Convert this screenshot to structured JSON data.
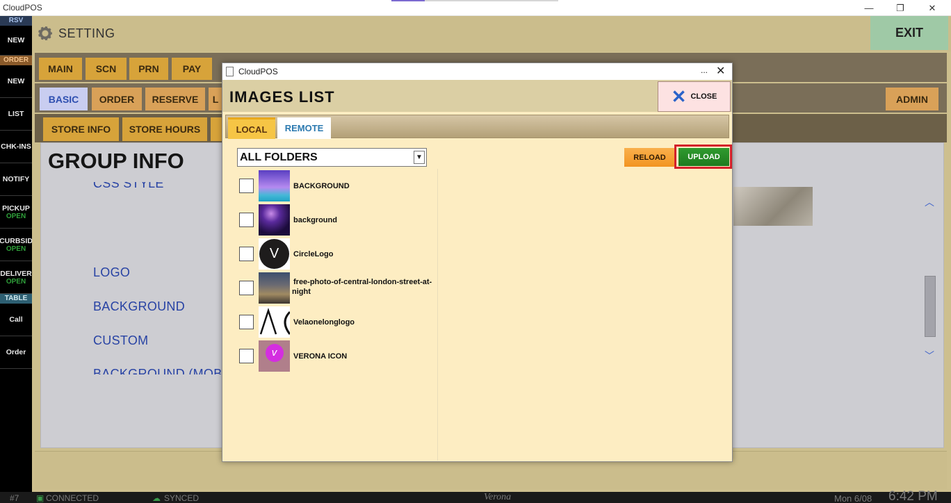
{
  "os": {
    "title": "CloudPOS",
    "minimize": "—",
    "restore": "❐",
    "close": "✕"
  },
  "sidebar": {
    "rsv_header": "RSV",
    "rsv_new": "NEW",
    "order_header": "ORDER",
    "order_new": "NEW",
    "list": "LIST",
    "chkins": "CHK-INS",
    "notify": "NOTIFY",
    "pickup": "PICKUP",
    "pickup_status": "OPEN",
    "curbside": "CURBSID",
    "curbside_status": "OPEN",
    "delivery": "DELIVER",
    "delivery_status": "OPEN",
    "table_header": "TABLE",
    "call": "Call",
    "order": "Order"
  },
  "header": {
    "title": "SETTING",
    "exit": "EXIT"
  },
  "main_tabs": [
    "MAIN",
    "SCN",
    "PRN",
    "PAY"
  ],
  "sub_tabs": {
    "basic": "BASIC",
    "order": "ORDER",
    "reserve": "RESERVE",
    "l": "L",
    "admin": "ADMIN"
  },
  "info_tabs": {
    "store_info": "STORE INFO",
    "store_hours": "STORE HOURS"
  },
  "content": {
    "group_title": "GROUP INFO",
    "labels": {
      "css_style": "CSS STYLE",
      "logo": "LOGO",
      "background": "BACKGROUND",
      "custom": "CUSTOM",
      "background_mobile": "BACKGROUND (MOBI"
    }
  },
  "statusbar": {
    "terminal": "#7",
    "connected": "CONNECTED",
    "synced": "SYNCED",
    "brand": "Verona",
    "date": "Mon 6/08",
    "time": "6:42 PM"
  },
  "dialog": {
    "window_title": "CloudPOS",
    "more": "...",
    "x": "✕",
    "heading": "IMAGES LIST",
    "close_label": "CLOSE",
    "tabs": {
      "local": "LOCAL",
      "remote": "REMOTE"
    },
    "folder_selected": "ALL FOLDERS",
    "reload": "RELOAD",
    "upload": "UPLOAD",
    "images": [
      {
        "name": "BACKGROUND",
        "icon": "purple-gradient-thumbnail"
      },
      {
        "name": "background",
        "icon": "dark-purple-thumbnail"
      },
      {
        "name": "CircleLogo",
        "icon": "circle-v-logo-thumbnail"
      },
      {
        "name": "free-photo-of-central-london-street-at-",
        "name2": "night",
        "icon": "london-street-thumbnail"
      },
      {
        "name": "Velaonelonglogo",
        "icon": "long-logo-thumbnail"
      },
      {
        "name": "VERONA ICON",
        "icon": "verona-icon-thumbnail"
      }
    ]
  },
  "colors": {
    "accent_upload": "#1f7a1f",
    "highlight_outline": "#d4202a",
    "reload": "#f29422",
    "sidebar_open": "#2fa03a"
  }
}
